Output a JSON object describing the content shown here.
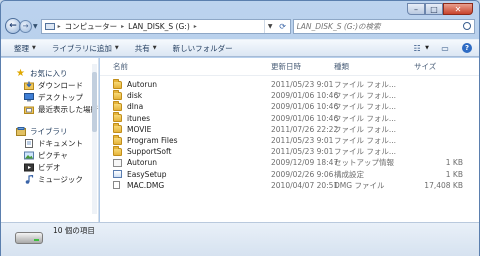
{
  "window": {
    "minimize": "–",
    "maximize": "□",
    "close": "✕"
  },
  "address": {
    "crumbs": [
      "コンピューター",
      "LAN_DISK_S (G:)"
    ],
    "search_placeholder": "LAN_DISK_S (G:)の検索"
  },
  "toolbar": {
    "organize": "整理",
    "add_to_library": "ライブラリに追加",
    "share": "共有",
    "new_folder": "新しいフォルダー"
  },
  "nav": {
    "favorites": {
      "label": "お気に入り",
      "items": [
        "ダウンロード",
        "デスクトップ",
        "最近表示した場所"
      ]
    },
    "libraries": {
      "label": "ライブラリ",
      "items": [
        "ドキュメント",
        "ピクチャ",
        "ビデオ",
        "ミュージック"
      ]
    }
  },
  "columns": {
    "name": "名前",
    "date": "更新日時",
    "type": "種類",
    "size": "サイズ"
  },
  "files": [
    {
      "name": "Autorun",
      "date": "2011/05/23 9:01",
      "type": "ファイル フォル...",
      "size": "",
      "icon": "folder"
    },
    {
      "name": "disk",
      "date": "2009/01/06 10:46",
      "type": "ファイル フォル...",
      "size": "",
      "icon": "folder"
    },
    {
      "name": "dlna",
      "date": "2009/01/06 10:46",
      "type": "ファイル フォル...",
      "size": "",
      "icon": "folder"
    },
    {
      "name": "itunes",
      "date": "2009/01/06 10:46",
      "type": "ファイル フォル...",
      "size": "",
      "icon": "folder"
    },
    {
      "name": "MOVIE",
      "date": "2011/07/26 22:22",
      "type": "ファイル フォル...",
      "size": "",
      "icon": "folder"
    },
    {
      "name": "Program Files",
      "date": "2011/05/23 9:01",
      "type": "ファイル フォル...",
      "size": "",
      "icon": "folder"
    },
    {
      "name": "SupportSoft",
      "date": "2011/05/23 9:01",
      "type": "ファイル フォル...",
      "size": "",
      "icon": "folder"
    },
    {
      "name": "Autorun",
      "date": "2009/12/09 18:47",
      "type": "セットアップ情報",
      "size": "1 KB",
      "icon": "setup"
    },
    {
      "name": "EasySetup",
      "date": "2009/02/26 9:06",
      "type": "構成設定",
      "size": "1 KB",
      "icon": "exe2"
    },
    {
      "name": "MAC.DMG",
      "date": "2010/04/07 20:51",
      "type": "DMG ファイル",
      "size": "17,408 KB",
      "icon": "doc"
    }
  ],
  "status": {
    "count": "10 個の項目"
  }
}
